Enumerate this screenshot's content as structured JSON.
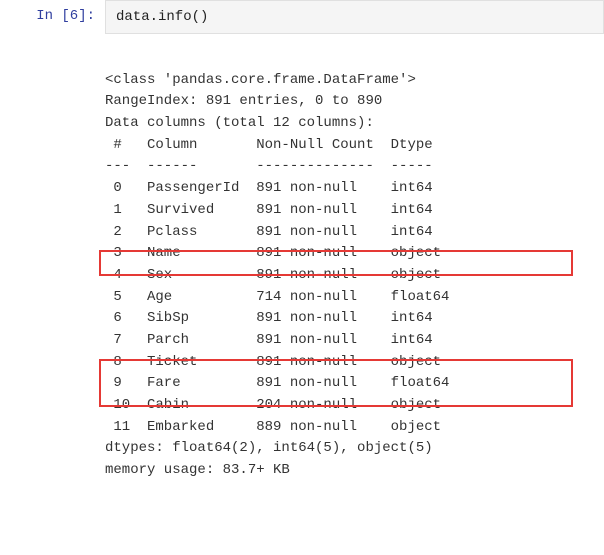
{
  "prompt": {
    "label": "In [6]:"
  },
  "code": {
    "line": "data.info()"
  },
  "out": {
    "class_line": "<class 'pandas.core.frame.DataFrame'>",
    "range_index": "RangeIndex: 891 entries, 0 to 890",
    "data_cols": "Data columns (total 12 columns):",
    "header": " #   Column       Non-Null Count  Dtype  ",
    "divider": "---  ------       --------------  -----  ",
    "rows": [
      " 0   PassengerId  891 non-null    int64  ",
      " 1   Survived     891 non-null    int64  ",
      " 2   Pclass       891 non-null    int64  ",
      " 3   Name         891 non-null    object ",
      " 4   Sex          891 non-null    object ",
      " 5   Age          714 non-null    float64",
      " 6   SibSp        891 non-null    int64  ",
      " 7   Parch        891 non-null    int64  ",
      " 8   Ticket       891 non-null    object ",
      " 9   Fare         891 non-null    float64",
      " 10  Cabin        204 non-null    object ",
      " 11  Embarked     889 non-null    object "
    ],
    "dtypes": "dtypes: float64(2), int64(5), object(5)",
    "memory": "memory usage: 83.7+ KB"
  },
  "chart_data": {
    "type": "table",
    "title": "pandas.DataFrame.info() output",
    "range_index": {
      "entries": 891,
      "start": 0,
      "stop": 890
    },
    "total_columns": 12,
    "columns": [
      {
        "index": 0,
        "name": "PassengerId",
        "non_null": 891,
        "dtype": "int64",
        "highlighted": false
      },
      {
        "index": 1,
        "name": "Survived",
        "non_null": 891,
        "dtype": "int64",
        "highlighted": false
      },
      {
        "index": 2,
        "name": "Pclass",
        "non_null": 891,
        "dtype": "int64",
        "highlighted": false
      },
      {
        "index": 3,
        "name": "Name",
        "non_null": 891,
        "dtype": "object",
        "highlighted": false
      },
      {
        "index": 4,
        "name": "Sex",
        "non_null": 891,
        "dtype": "object",
        "highlighted": false
      },
      {
        "index": 5,
        "name": "Age",
        "non_null": 714,
        "dtype": "float64",
        "highlighted": true
      },
      {
        "index": 6,
        "name": "SibSp",
        "non_null": 891,
        "dtype": "int64",
        "highlighted": false
      },
      {
        "index": 7,
        "name": "Parch",
        "non_null": 891,
        "dtype": "int64",
        "highlighted": false
      },
      {
        "index": 8,
        "name": "Ticket",
        "non_null": 891,
        "dtype": "object",
        "highlighted": false
      },
      {
        "index": 9,
        "name": "Fare",
        "non_null": 891,
        "dtype": "float64",
        "highlighted": false
      },
      {
        "index": 10,
        "name": "Cabin",
        "non_null": 204,
        "dtype": "object",
        "highlighted": true
      },
      {
        "index": 11,
        "name": "Embarked",
        "non_null": 889,
        "dtype": "object",
        "highlighted": true
      }
    ],
    "dtype_summary": {
      "float64": 2,
      "int64": 5,
      "object": 5
    },
    "memory_usage": "83.7+ KB"
  }
}
